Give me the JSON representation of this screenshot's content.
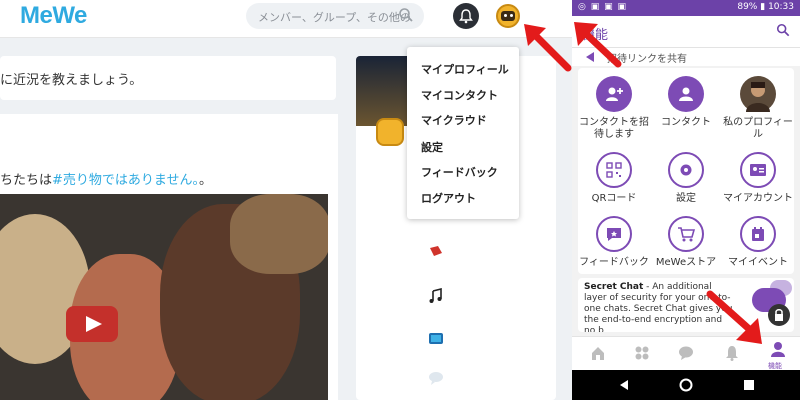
{
  "desktop": {
    "logo": "MeWe",
    "search": {
      "placeholder": "メンバー、グループ、その他の"
    },
    "status_prompt": "に近況を教えましょう。",
    "post": {
      "text_prefix": "ちたちは",
      "hashtag": "#売り物ではありません。",
      "text_suffix": "。"
    },
    "profile_menu": {
      "items": [
        "マイプロフィール",
        "マイコンタクト",
        "マイクラウド",
        "設定",
        "フィードバック",
        "ログアウト"
      ]
    },
    "side_icons": [
      "book-icon",
      "music-icon",
      "tv-icon",
      "chat-icon"
    ]
  },
  "phone": {
    "status_bar": {
      "time": "10:33",
      "battery": "89%"
    },
    "title": "機能",
    "invite_text": "招待リンクを共有",
    "features": [
      {
        "label": "コンタクトを招待します",
        "icon": "add-contact-icon",
        "style": "fill"
      },
      {
        "label": "コンタクト",
        "icon": "contact-icon",
        "style": "fill"
      },
      {
        "label": "私のプロフィール",
        "icon": "profile-photo",
        "style": "photo"
      },
      {
        "label": "QRコード",
        "icon": "qr-code-icon",
        "style": "outline"
      },
      {
        "label": "設定",
        "icon": "gear-icon",
        "style": "outline"
      },
      {
        "label": "マイアカウント",
        "icon": "id-card-icon",
        "style": "outline"
      },
      {
        "label": "フィードバック",
        "icon": "feedback-icon",
        "style": "outline"
      },
      {
        "label": "MeWeストア",
        "icon": "cart-icon",
        "style": "outline"
      },
      {
        "label": "マイイベント",
        "icon": "calendar-icon",
        "style": "outline"
      }
    ],
    "secret_chat": {
      "title": "Secret Chat",
      "body": " - An additional layer of security for your one-to-one chats. Secret Chat gives you the end-to-end encryption and no b"
    },
    "bottom_nav": {
      "items": [
        "home-icon",
        "groups-icon",
        "chat-icon",
        "bell-icon",
        "person-icon"
      ],
      "active_label": "機能"
    }
  },
  "colors": {
    "brand_blue": "#2faae0",
    "purple": "#7d4bb5",
    "arrow_red": "#e31b1b"
  }
}
